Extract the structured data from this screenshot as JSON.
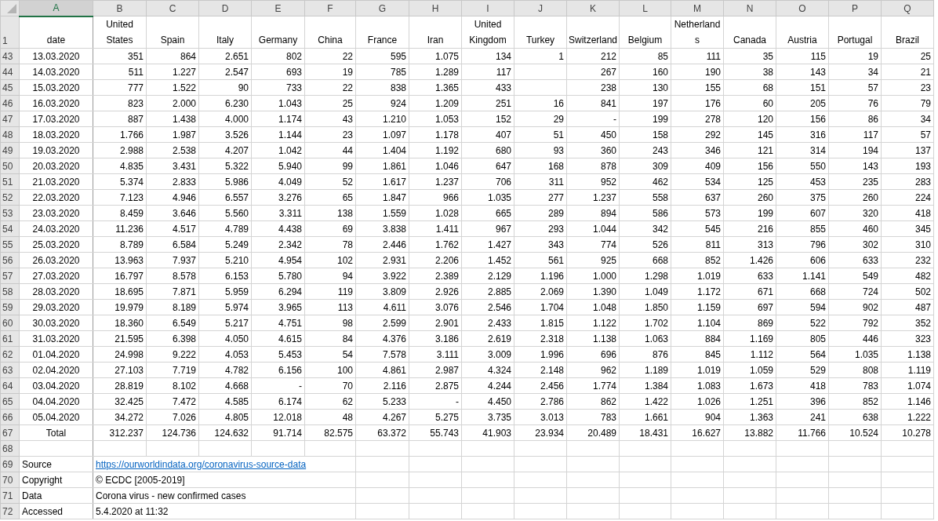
{
  "column_letters": [
    {
      "letter": "A",
      "selected": true
    },
    {
      "letter": "B",
      "selected": false
    },
    {
      "letter": "C",
      "selected": false
    },
    {
      "letter": "D",
      "selected": false
    },
    {
      "letter": "E",
      "selected": false
    },
    {
      "letter": "F",
      "selected": false
    },
    {
      "letter": "G",
      "selected": false
    },
    {
      "letter": "H",
      "selected": false
    },
    {
      "letter": "I",
      "selected": false
    },
    {
      "letter": "J",
      "selected": false
    },
    {
      "letter": "K",
      "selected": false
    },
    {
      "letter": "L",
      "selected": false
    },
    {
      "letter": "M",
      "selected": false
    },
    {
      "letter": "N",
      "selected": false
    },
    {
      "letter": "O",
      "selected": false
    },
    {
      "letter": "P",
      "selected": false
    },
    {
      "letter": "Q",
      "selected": false
    }
  ],
  "rows": [
    {
      "number": "1",
      "kind": "header",
      "cells": [
        "date",
        "United States",
        "Spain",
        "Italy",
        "Germany",
        "China",
        "France",
        "Iran",
        "United Kingdom",
        "Turkey",
        "Switzerland",
        "Belgium",
        "Netherlands",
        "Canada",
        "Austria",
        "Portugal",
        "Brazil"
      ]
    },
    {
      "number": "43",
      "kind": "data",
      "cells": [
        "13.03.2020",
        "351",
        "864",
        "2.651",
        "802",
        "22",
        "595",
        "1.075",
        "134",
        "1",
        "212",
        "85",
        "111",
        "35",
        "115",
        "19",
        "25"
      ]
    },
    {
      "number": "44",
      "kind": "data",
      "cells": [
        "14.03.2020",
        "511",
        "1.227",
        "2.547",
        "693",
        "19",
        "785",
        "1.289",
        "117",
        null,
        "267",
        "160",
        "190",
        "38",
        "143",
        "34",
        "21"
      ]
    },
    {
      "number": "45",
      "kind": "data",
      "cells": [
        "15.03.2020",
        "777",
        "1.522",
        "90",
        "733",
        "22",
        "838",
        "1.365",
        "433",
        null,
        "238",
        "130",
        "155",
        "68",
        "151",
        "57",
        "23"
      ]
    },
    {
      "number": "46",
      "kind": "data",
      "cells": [
        "16.03.2020",
        "823",
        "2.000",
        "6.230",
        "1.043",
        "25",
        "924",
        "1.209",
        "251",
        "16",
        "841",
        "197",
        "176",
        "60",
        "205",
        "76",
        "79"
      ]
    },
    {
      "number": "47",
      "kind": "data",
      "cells": [
        "17.03.2020",
        "887",
        "1.438",
        "4.000",
        "1.174",
        "43",
        "1.210",
        "1.053",
        "152",
        "29",
        "-",
        "199",
        "278",
        "120",
        "156",
        "86",
        "34"
      ]
    },
    {
      "number": "48",
      "kind": "data",
      "cells": [
        "18.03.2020",
        "1.766",
        "1.987",
        "3.526",
        "1.144",
        "23",
        "1.097",
        "1.178",
        "407",
        "51",
        "450",
        "158",
        "292",
        "145",
        "316",
        "117",
        "57"
      ]
    },
    {
      "number": "49",
      "kind": "data",
      "cells": [
        "19.03.2020",
        "2.988",
        "2.538",
        "4.207",
        "1.042",
        "44",
        "1.404",
        "1.192",
        "680",
        "93",
        "360",
        "243",
        "346",
        "121",
        "314",
        "194",
        "137"
      ]
    },
    {
      "number": "50",
      "kind": "data",
      "cells": [
        "20.03.2020",
        "4.835",
        "3.431",
        "5.322",
        "5.940",
        "99",
        "1.861",
        "1.046",
        "647",
        "168",
        "878",
        "309",
        "409",
        "156",
        "550",
        "143",
        "193"
      ]
    },
    {
      "number": "51",
      "kind": "data",
      "cells": [
        "21.03.2020",
        "5.374",
        "2.833",
        "5.986",
        "4.049",
        "52",
        "1.617",
        "1.237",
        "706",
        "311",
        "952",
        "462",
        "534",
        "125",
        "453",
        "235",
        "283"
      ]
    },
    {
      "number": "52",
      "kind": "data",
      "cells": [
        "22.03.2020",
        "7.123",
        "4.946",
        "6.557",
        "3.276",
        "65",
        "1.847",
        "966",
        "1.035",
        "277",
        "1.237",
        "558",
        "637",
        "260",
        "375",
        "260",
        "224"
      ]
    },
    {
      "number": "53",
      "kind": "data",
      "cells": [
        "23.03.2020",
        "8.459",
        "3.646",
        "5.560",
        "3.311",
        "138",
        "1.559",
        "1.028",
        "665",
        "289",
        "894",
        "586",
        "573",
        "199",
        "607",
        "320",
        "418"
      ]
    },
    {
      "number": "54",
      "kind": "data",
      "cells": [
        "24.03.2020",
        "11.236",
        "4.517",
        "4.789",
        "4.438",
        "69",
        "3.838",
        "1.411",
        "967",
        "293",
        "1.044",
        "342",
        "545",
        "216",
        "855",
        "460",
        "345"
      ]
    },
    {
      "number": "55",
      "kind": "data",
      "cells": [
        "25.03.2020",
        "8.789",
        "6.584",
        "5.249",
        "2.342",
        "78",
        "2.446",
        "1.762",
        "1.427",
        "343",
        "774",
        "526",
        "811",
        "313",
        "796",
        "302",
        "310"
      ]
    },
    {
      "number": "56",
      "kind": "data",
      "cells": [
        "26.03.2020",
        "13.963",
        "7.937",
        "5.210",
        "4.954",
        "102",
        "2.931",
        "2.206",
        "1.452",
        "561",
        "925",
        "668",
        "852",
        "1.426",
        "606",
        "633",
        "232"
      ]
    },
    {
      "number": "57",
      "kind": "data",
      "cells": [
        "27.03.2020",
        "16.797",
        "8.578",
        "6.153",
        "5.780",
        "94",
        "3.922",
        "2.389",
        "2.129",
        "1.196",
        "1.000",
        "1.298",
        "1.019",
        "633",
        "1.141",
        "549",
        "482"
      ]
    },
    {
      "number": "58",
      "kind": "data",
      "cells": [
        "28.03.2020",
        "18.695",
        "7.871",
        "5.959",
        "6.294",
        "119",
        "3.809",
        "2.926",
        "2.885",
        "2.069",
        "1.390",
        "1.049",
        "1.172",
        "671",
        "668",
        "724",
        "502"
      ]
    },
    {
      "number": "59",
      "kind": "data",
      "cells": [
        "29.03.2020",
        "19.979",
        "8.189",
        "5.974",
        "3.965",
        "113",
        "4.611",
        "3.076",
        "2.546",
        "1.704",
        "1.048",
        "1.850",
        "1.159",
        "697",
        "594",
        "902",
        "487"
      ]
    },
    {
      "number": "60",
      "kind": "data",
      "cells": [
        "30.03.2020",
        "18.360",
        "6.549",
        "5.217",
        "4.751",
        "98",
        "2.599",
        "2.901",
        "2.433",
        "1.815",
        "1.122",
        "1.702",
        "1.104",
        "869",
        "522",
        "792",
        "352"
      ]
    },
    {
      "number": "61",
      "kind": "data",
      "cells": [
        "31.03.2020",
        "21.595",
        "6.398",
        "4.050",
        "4.615",
        "84",
        "4.376",
        "3.186",
        "2.619",
        "2.318",
        "1.138",
        "1.063",
        "884",
        "1.169",
        "805",
        "446",
        "323"
      ]
    },
    {
      "number": "62",
      "kind": "data",
      "cells": [
        "01.04.2020",
        "24.998",
        "9.222",
        "4.053",
        "5.453",
        "54",
        "7.578",
        "3.111",
        "3.009",
        "1.996",
        "696",
        "876",
        "845",
        "1.112",
        "564",
        "1.035",
        "1.138"
      ]
    },
    {
      "number": "63",
      "kind": "data",
      "cells": [
        "02.04.2020",
        "27.103",
        "7.719",
        "4.782",
        "6.156",
        "100",
        "4.861",
        "2.987",
        "4.324",
        "2.148",
        "962",
        "1.189",
        "1.019",
        "1.059",
        "529",
        "808",
        "1.119"
      ]
    },
    {
      "number": "64",
      "kind": "data",
      "cells": [
        "03.04.2020",
        "28.819",
        "8.102",
        "4.668",
        "-",
        "70",
        "2.116",
        "2.875",
        "4.244",
        "2.456",
        "1.774",
        "1.384",
        "1.083",
        "1.673",
        "418",
        "783",
        "1.074"
      ]
    },
    {
      "number": "65",
      "kind": "data",
      "cells": [
        "04.04.2020",
        "32.425",
        "7.472",
        "4.585",
        "6.174",
        "62",
        "5.233",
        "-",
        "4.450",
        "2.786",
        "862",
        "1.422",
        "1.026",
        "1.251",
        "396",
        "852",
        "1.146"
      ]
    },
    {
      "number": "66",
      "kind": "data",
      "cells": [
        "05.04.2020",
        "34.272",
        "7.026",
        "4.805",
        "12.018",
        "48",
        "4.267",
        "5.275",
        "3.735",
        "3.013",
        "783",
        "1.661",
        "904",
        "1.363",
        "241",
        "638",
        "1.222"
      ]
    },
    {
      "number": "67",
      "kind": "total",
      "cells": [
        "Total",
        "312.237",
        "124.736",
        "124.632",
        "91.714",
        "82.575",
        "63.372",
        "55.743",
        "41.903",
        "23.934",
        "20.489",
        "18.431",
        "16.627",
        "13.882",
        "11.766",
        "10.524",
        "10.278"
      ]
    },
    {
      "number": "68",
      "kind": "blank"
    },
    {
      "number": "69",
      "kind": "link",
      "label": "Source",
      "value": "https://ourworldindata.org/coronavirus-source-data"
    },
    {
      "number": "70",
      "kind": "note",
      "label": "Copyright",
      "value": "© ECDC [2005-2019]"
    },
    {
      "number": "71",
      "kind": "note",
      "label": "Data",
      "value": "Corona virus - new confirmed cases"
    },
    {
      "number": "72",
      "kind": "note",
      "label": "Accessed",
      "value": "5.4.2020 at 11:32"
    }
  ]
}
